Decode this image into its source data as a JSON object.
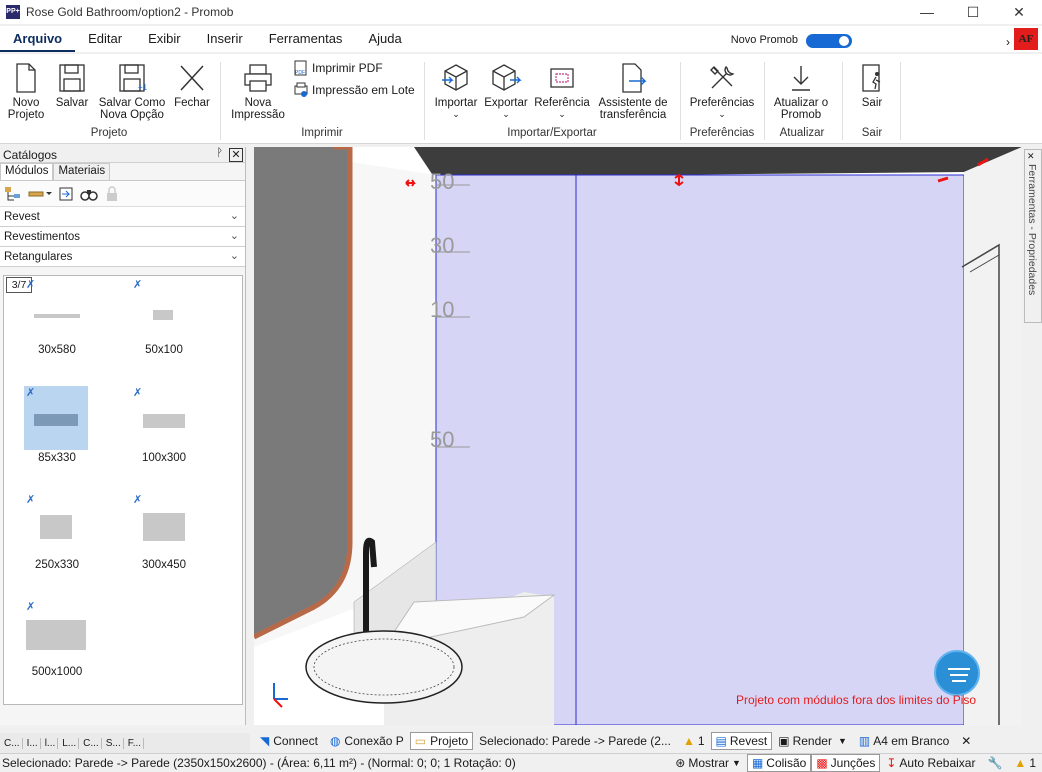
{
  "window": {
    "title": "Rose Gold Bathroom/option2 - Promob",
    "app_icon": "PP+",
    "minimize": "—",
    "maximize": "☐",
    "close": "✕"
  },
  "menu": {
    "items": [
      "Arquivo",
      "Editar",
      "Exibir",
      "Inserir",
      "Ferramentas",
      "Ajuda"
    ],
    "novo_promob": "Novo Promob",
    "more": "›",
    "user_badge": "AF"
  },
  "ribbon": {
    "projeto": {
      "novo": [
        "Novo",
        "Projeto"
      ],
      "salvar": "Salvar",
      "salvar_como": [
        "Salvar Como",
        "Nova Opção"
      ],
      "fechar": "Fechar",
      "label": "Projeto"
    },
    "imprimir": {
      "nova_impressao": [
        "Nova",
        "Impressão"
      ],
      "imprimir_pdf": "Imprimir PDF",
      "impressao_lote": "Impressão em Lote",
      "label": "Imprimir"
    },
    "importar_exportar": {
      "importar": "Importar",
      "exportar": "Exportar",
      "referencia": "Referência",
      "assistente": [
        "Assistente de",
        "transferência"
      ],
      "label": "Importar/Exportar"
    },
    "preferencias": {
      "btn": "Preferências",
      "label": "Preferências"
    },
    "atualizar": {
      "btn": [
        "Atualizar o",
        "Promob"
      ],
      "label": "Atualizar"
    },
    "sair": {
      "btn": "Sair",
      "label": "Sair"
    }
  },
  "catalog": {
    "title": "Catálogos",
    "pin": "📌",
    "close": "✕",
    "tabs": [
      "Módulos",
      "Materiais"
    ],
    "select1": "Revest",
    "select2": "Revestimentos",
    "select3": "Retangulares",
    "page_indicator": "3/7",
    "tiles": [
      {
        "label": "30x580"
      },
      {
        "label": "50x100"
      },
      {
        "label": "85x330"
      },
      {
        "label": "100x300"
      },
      {
        "label": "250x330"
      },
      {
        "label": "300x450"
      },
      {
        "label": "500x1000"
      }
    ]
  },
  "bottom_tabs": [
    "C...",
    "I...",
    "l...",
    "L...",
    "C...",
    "S...",
    "F..."
  ],
  "viewport": {
    "dim_labels": [
      "50",
      "30",
      "10",
      "50"
    ],
    "hint": "Projeto com módulos fora dos limites do Piso"
  },
  "right_strip": {
    "label": "Ferramentas - Propriedades"
  },
  "status1": {
    "connect": "Connect",
    "conexao": "Conexão P",
    "projeto": "Projeto",
    "selecionado": "Selecionado: Parede -> Parede (2...",
    "warning_count": "1",
    "revest": "Revest",
    "render": "Render",
    "a4": "A4 em Branco",
    "close": "✕"
  },
  "status2": {
    "info": "Selecionado: Parede -> Parede (2350x150x2600) - (Área: 6,11 m²) - (Normal: 0; 0; 1 Rotação: 0)",
    "mostrar": "Mostrar",
    "colisao": "Colisão",
    "juncoes": "Junções",
    "auto_rebaixar": "Auto Rebaixar",
    "warning_count": "1"
  }
}
